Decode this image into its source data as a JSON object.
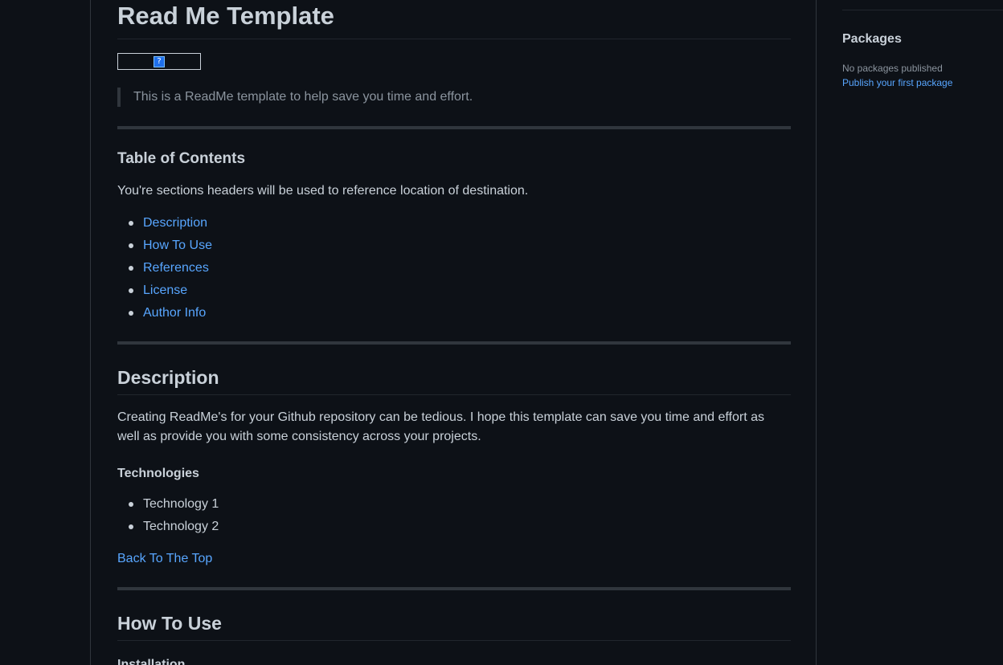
{
  "readme": {
    "title": "Read Me Template",
    "badge_icon": "?",
    "blockquote": "This is a ReadMe template to help save you time and effort.",
    "toc": {
      "heading": "Table of Contents",
      "intro": "You're sections headers will be used to reference location of destination.",
      "items": [
        "Description",
        "How To Use",
        "References",
        "License",
        "Author Info"
      ]
    },
    "description": {
      "heading": "Description",
      "body_line1": "Creating ReadMe's for your Github repository can be tedious. I hope this template can save you time and effort as",
      "body_line2": "well as provide you with some consistency across your projects.",
      "technologies_heading": "Technologies",
      "technologies": [
        "Technology 1",
        "Technology 2"
      ],
      "back_to_top": "Back To The Top"
    },
    "how_to_use": {
      "heading": "How To Use",
      "sub_heading": "Installation"
    }
  },
  "sidebar": {
    "packages_title": "Packages",
    "packages_empty": "No packages published",
    "packages_link": "Publish your first package"
  },
  "colors": {
    "background": "#0d1117",
    "text": "#c9d1d9",
    "link": "#58a6ff",
    "muted": "#8b949e",
    "border": "#30363d"
  }
}
